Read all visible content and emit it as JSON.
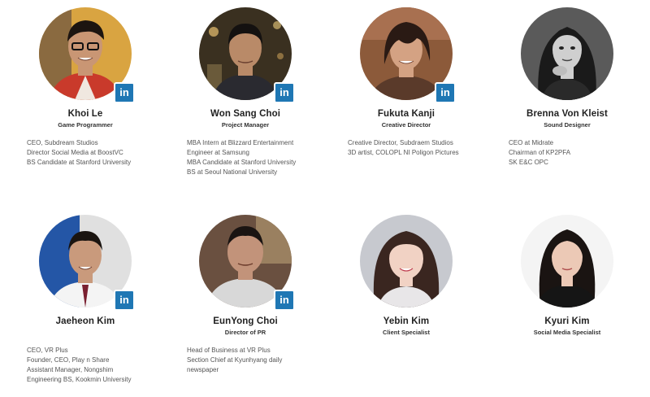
{
  "members": [
    {
      "name": "Khoi Le",
      "role": "Game Programmer",
      "bio": [
        "CEO, Subdream Studios",
        "Director Social Media at BoostVC",
        "BS Candidate at Stanford University"
      ],
      "linkedin": true,
      "colors": {
        "bg": "#d9a441",
        "skin": "#c99674",
        "hair": "#1c1410",
        "cloth": "#c93a2b"
      }
    },
    {
      "name": "Won Sang Choi",
      "role": "Project Manager",
      "bio": [
        "MBA Intern at Blizzard Entertainment",
        "Engineer at Samsung",
        "MBA Candidate at Stanford University",
        "BS at Seoul National University"
      ],
      "linkedin": true,
      "colors": {
        "bg": "#3a3020",
        "skin": "#b98a68",
        "hair": "#141110",
        "cloth": "#2a2a30"
      }
    },
    {
      "name": "Fukuta Kanji",
      "role": "Creative Director",
      "bio": [
        "Creative Director, Subdraem Studios",
        "3D artist, COLOPL NI Poligon Pictures"
      ],
      "linkedin": true,
      "colors": {
        "bg": "#8c5a3a",
        "skin": "#d4a283",
        "hair": "#2a1a14",
        "cloth": "#5a3a2a"
      }
    },
    {
      "name": "Brenna Von Kleist",
      "role": "Sound Designer",
      "bio": [
        "CEO at Midrate",
        "Chairman of KP2PFA",
        "SK E&C OPC"
      ],
      "linkedin": false,
      "colors": {
        "bg": "#5a5a5a",
        "skin": "#cfcfcf",
        "hair": "#1a1a1a",
        "cloth": "#2a2a2a"
      }
    },
    {
      "name": "Jaeheon Kim",
      "role": "",
      "bio": [
        "CEO, VR Plus",
        "Founder, CEO, Play n Share",
        "Assistant Manager, Nongshim",
        "Engineering BS, Kookmin University"
      ],
      "linkedin": true,
      "colors": {
        "bg": "#2456a6",
        "skin": "#c99a7c",
        "hair": "#1a1410",
        "cloth": "#f4f4f4"
      }
    },
    {
      "name": "EunYong Choi",
      "role": "Director of PR",
      "bio": [
        "Head of Business at VR Plus",
        "Section Chief at Kyunhyang daily",
        "newspaper"
      ],
      "linkedin": true,
      "colors": {
        "bg": "#6a5040",
        "skin": "#c2937a",
        "hair": "#1a1412",
        "cloth": "#d8d8d8"
      }
    },
    {
      "name": "Yebin Kim",
      "role": "Client Specialist",
      "bio": [],
      "linkedin": false,
      "colors": {
        "bg": "#c7c9cf",
        "skin": "#f1d2c4",
        "hair": "#3a2620",
        "cloth": "#e8e6e8"
      }
    },
    {
      "name": "Kyuri Kim",
      "role": "Social Media Specialist",
      "bio": [],
      "linkedin": false,
      "colors": {
        "bg": "#f4f4f4",
        "skin": "#ecc9b6",
        "hair": "#1a1412",
        "cloth": "#151515"
      }
    }
  ],
  "icons": {
    "linkedin": "in"
  }
}
